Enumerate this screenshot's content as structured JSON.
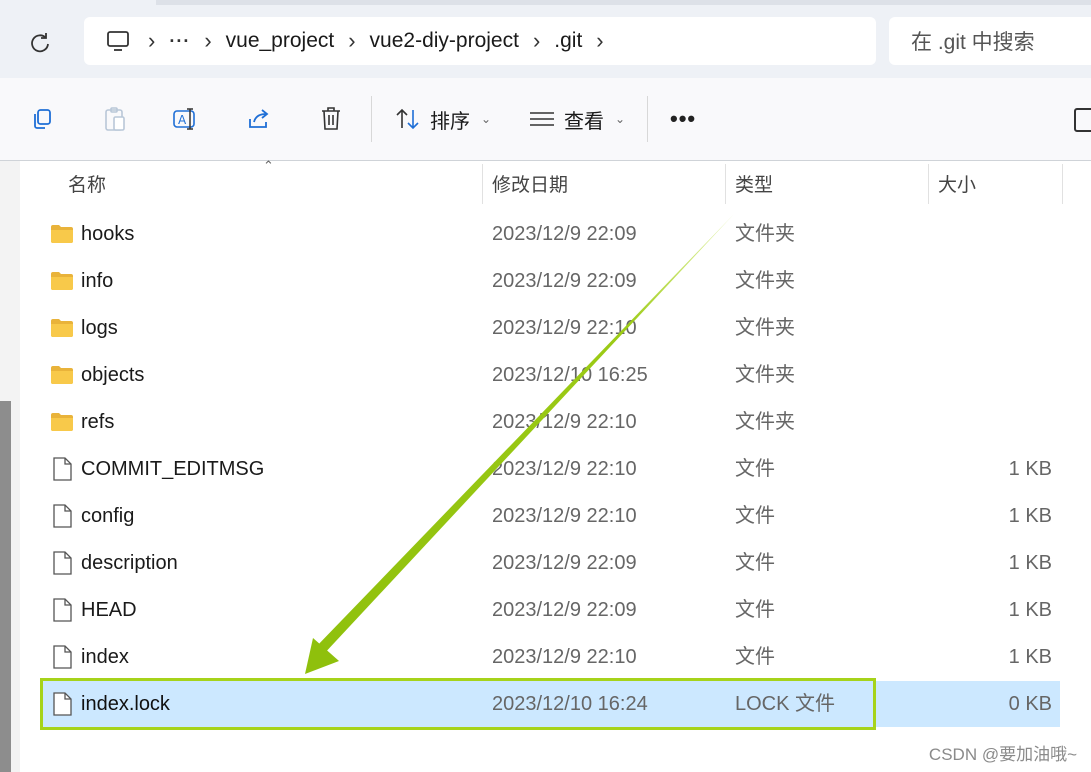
{
  "address": {
    "crumbs": [
      "vue_project",
      "vue2-diy-project",
      ".git"
    ],
    "search_placeholder": "在 .git 中搜索"
  },
  "toolbar": {
    "sort_label": "排序",
    "view_label": "查看"
  },
  "columns": {
    "name": "名称",
    "date": "修改日期",
    "type": "类型",
    "size": "大小"
  },
  "files": [
    {
      "name": "hooks",
      "date": "2023/12/9 22:09",
      "type": "文件夹",
      "size": "",
      "kind": "folder"
    },
    {
      "name": "info",
      "date": "2023/12/9 22:09",
      "type": "文件夹",
      "size": "",
      "kind": "folder"
    },
    {
      "name": "logs",
      "date": "2023/12/9 22:10",
      "type": "文件夹",
      "size": "",
      "kind": "folder"
    },
    {
      "name": "objects",
      "date": "2023/12/10 16:25",
      "type": "文件夹",
      "size": "",
      "kind": "folder"
    },
    {
      "name": "refs",
      "date": "2023/12/9 22:10",
      "type": "文件夹",
      "size": "",
      "kind": "folder"
    },
    {
      "name": "COMMIT_EDITMSG",
      "date": "2023/12/9 22:10",
      "type": "文件",
      "size": "1 KB",
      "kind": "file"
    },
    {
      "name": "config",
      "date": "2023/12/9 22:10",
      "type": "文件",
      "size": "1 KB",
      "kind": "file"
    },
    {
      "name": "description",
      "date": "2023/12/9 22:09",
      "type": "文件",
      "size": "1 KB",
      "kind": "file"
    },
    {
      "name": "HEAD",
      "date": "2023/12/9 22:09",
      "type": "文件",
      "size": "1 KB",
      "kind": "file"
    },
    {
      "name": "index",
      "date": "2023/12/9 22:10",
      "type": "文件",
      "size": "1 KB",
      "kind": "file"
    },
    {
      "name": "index.lock",
      "date": "2023/12/10 16:24",
      "type": "LOCK 文件",
      "size": "0 KB",
      "kind": "file",
      "selected": true
    }
  ],
  "watermark": "CSDN @要加油哦~",
  "colors": {
    "selection": "#cce8ff",
    "highlight": "#a6d31a",
    "folder": "#f8c94a"
  },
  "icons": [
    "refresh-icon",
    "this-pc-icon",
    "copy-icon",
    "paste-icon",
    "rename-icon",
    "share-icon",
    "delete-icon",
    "sort-icon",
    "view-icon",
    "more-icon",
    "folder-icon",
    "file-icon"
  ]
}
